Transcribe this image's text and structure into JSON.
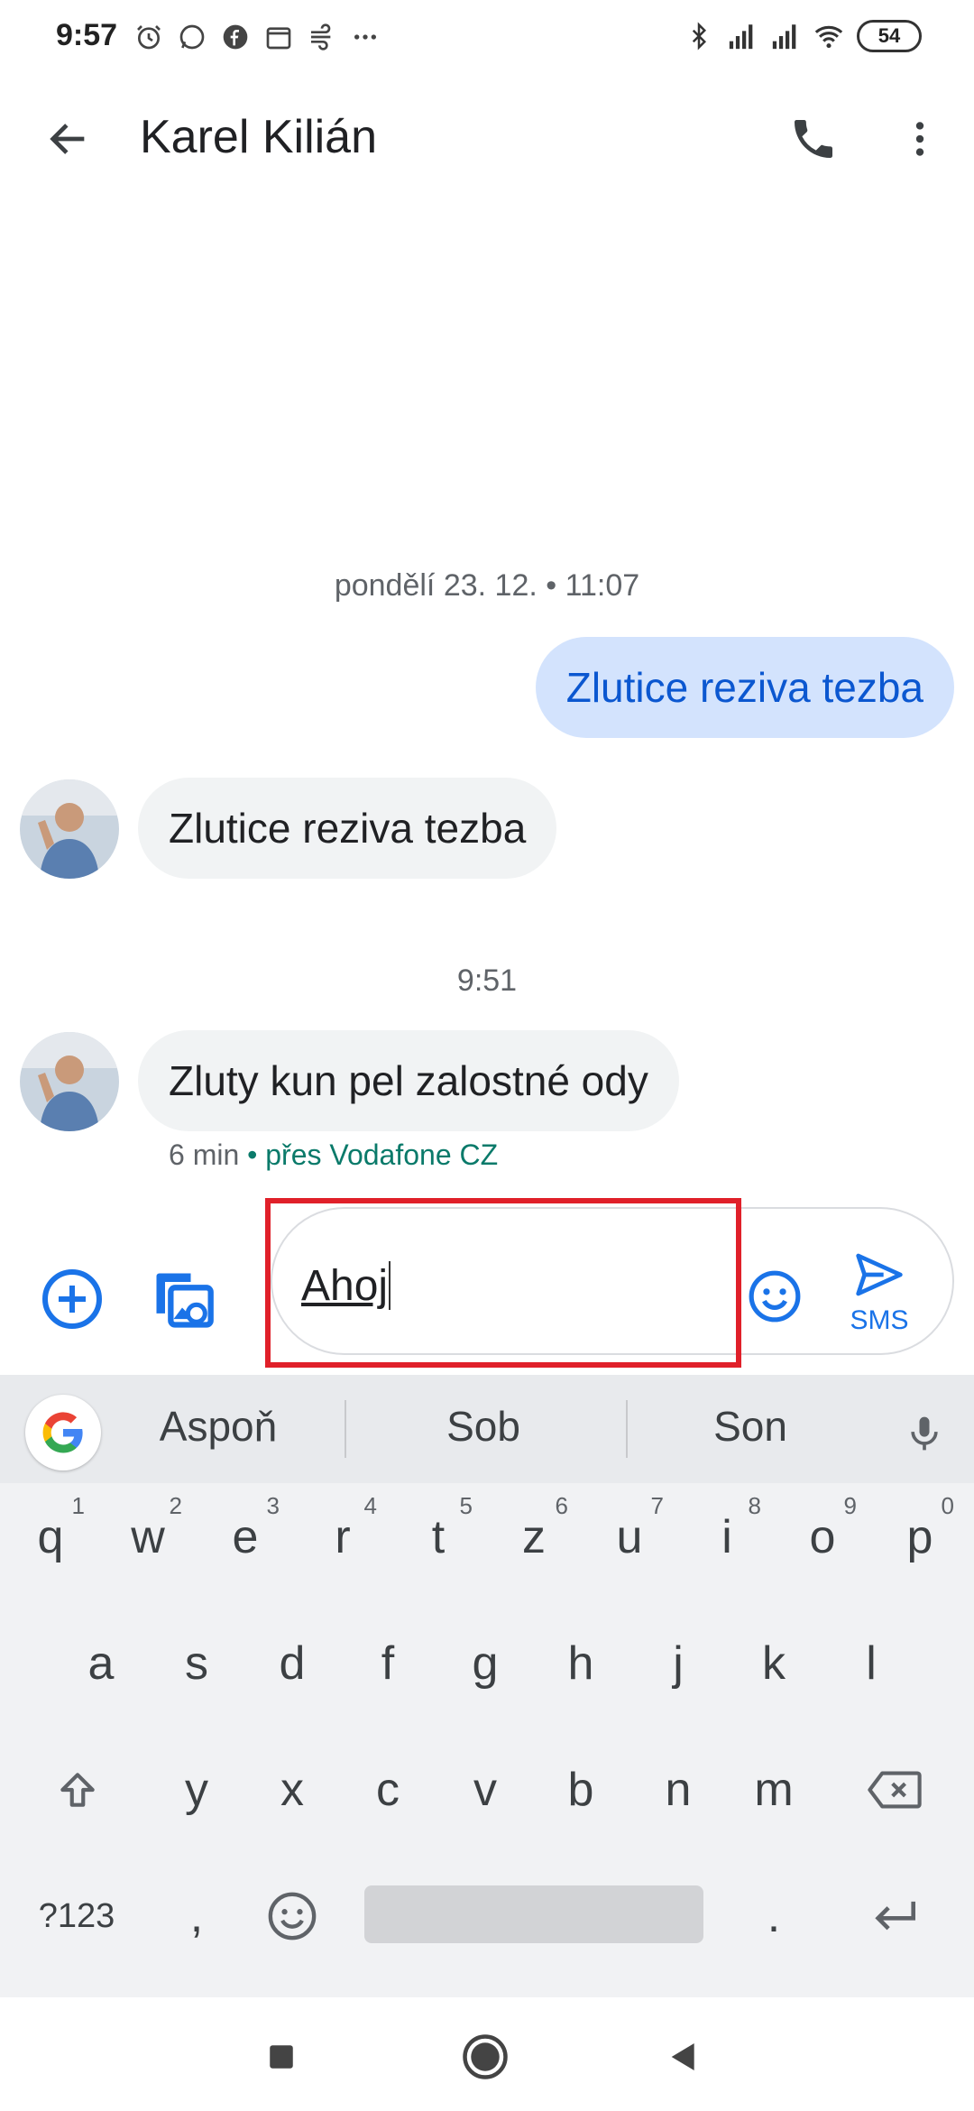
{
  "status_bar": {
    "time": "9:57",
    "battery": "54"
  },
  "header": {
    "contact_name": "Karel Kilián"
  },
  "conversation": {
    "timestamp1": "pondělí 23. 12. • 11:07",
    "outgoing_msg": "Zlutice reziva tezba",
    "incoming_msg1": "Zlutice reziva tezba",
    "timestamp2": "9:51",
    "incoming_msg2": "Zluty kun pel zalostné ody",
    "meta_time": "6 min",
    "meta_via": " • přes Vodafone CZ"
  },
  "compose": {
    "text": "Ahoj",
    "send_label": "SMS"
  },
  "keyboard": {
    "suggestions": [
      "Aspoň",
      "Sob",
      "Son"
    ],
    "row1": [
      "q",
      "w",
      "e",
      "r",
      "t",
      "z",
      "u",
      "i",
      "o",
      "p"
    ],
    "row1_hints": [
      "1",
      "2",
      "3",
      "4",
      "5",
      "6",
      "7",
      "8",
      "9",
      "0"
    ],
    "row2": [
      "a",
      "s",
      "d",
      "f",
      "g",
      "h",
      "j",
      "k",
      "l"
    ],
    "row3": [
      "y",
      "x",
      "c",
      "v",
      "b",
      "n",
      "m"
    ],
    "symbols_label": "?123",
    "comma": ",",
    "period": "."
  },
  "colors": {
    "accent": "#1a73e8",
    "outgoing_bubble": "#d3e3fd",
    "highlight": "#e0202a"
  }
}
